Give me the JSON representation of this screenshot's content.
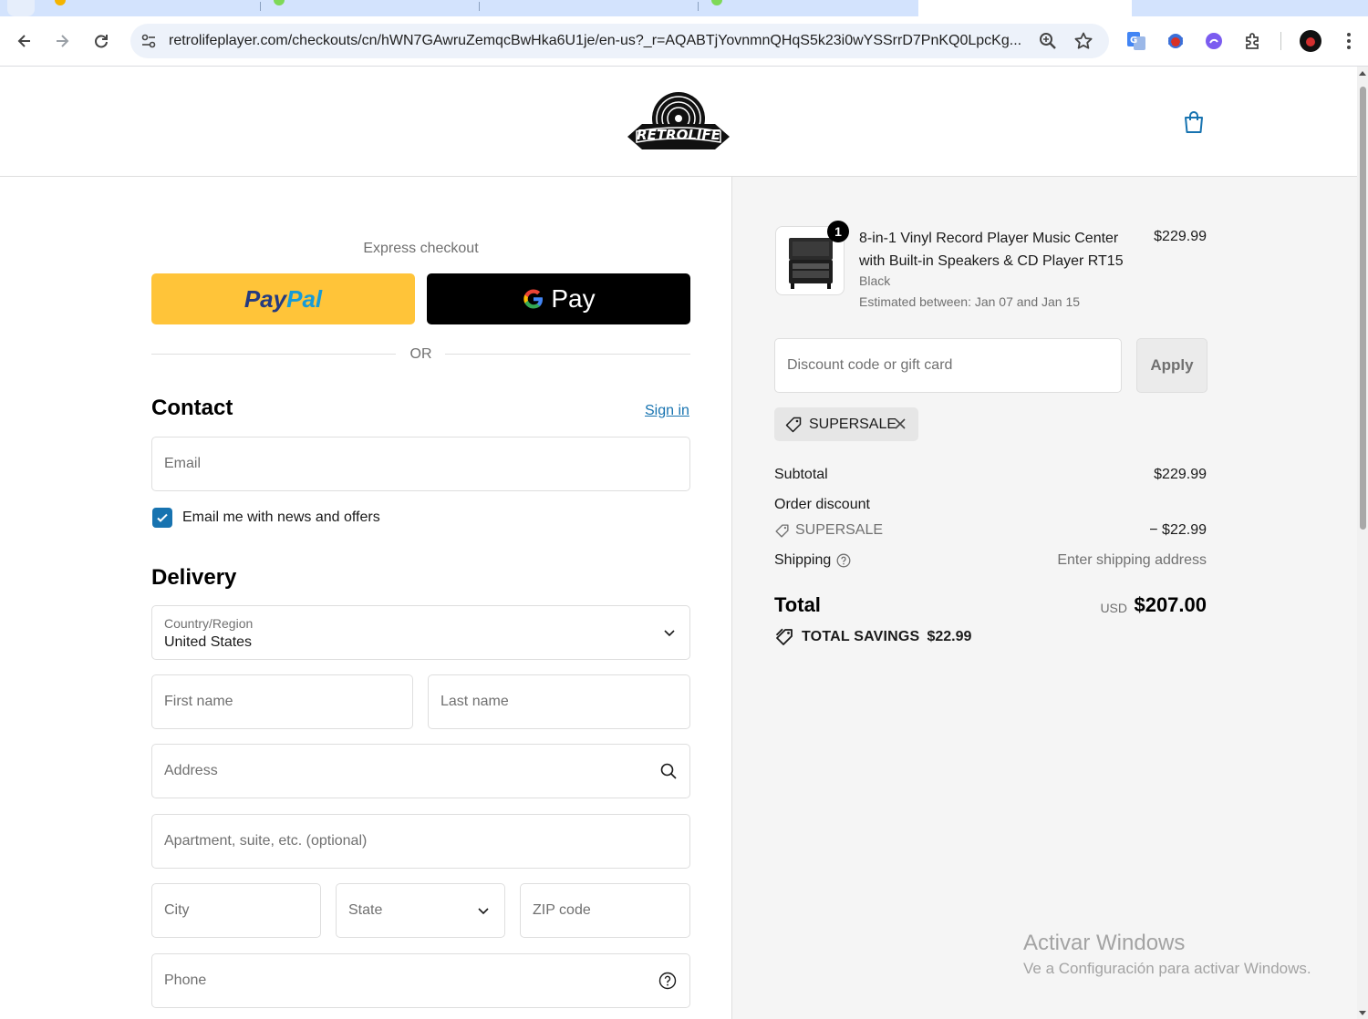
{
  "browser": {
    "url": "retrolifeplayer.com/checkouts/cn/hWN7GAwruZemqcBwHka6U1je/en-us?_r=AQABTjYovnmnQHqS5k23i0wYSSrrD7PnKQ0LpcKg...",
    "icons": [
      "back-icon",
      "forward-icon",
      "reload-icon",
      "site-settings-icon",
      "zoom-icon",
      "bookmark-star-icon",
      "translate-extension-icon",
      "bug-extension-icon",
      "purple-extension-icon",
      "puzzle-extensions-icon",
      "profile-avatar",
      "kebab-menu-icon"
    ]
  },
  "store": {
    "logo_text": "RETROLIFE",
    "cart_icon": "shopping-bag-icon"
  },
  "checkout": {
    "express_label": "Express checkout",
    "paypal_label_1": "Pay",
    "paypal_label_2": "Pal",
    "gpay_label": "Pay",
    "or_label": "OR",
    "contact_heading": "Contact",
    "sign_in": "Sign in",
    "email_placeholder": "Email",
    "newsletter_label": "Email me with news and offers",
    "newsletter_checked": true,
    "delivery_heading": "Delivery",
    "country_label": "Country/Region",
    "country_value": "United States",
    "first_name_placeholder": "First name",
    "last_name_placeholder": "Last name",
    "address_placeholder": "Address",
    "apartment_placeholder": "Apartment, suite, etc. (optional)",
    "city_placeholder": "City",
    "state_placeholder": "State",
    "zip_placeholder": "ZIP code",
    "phone_placeholder": "Phone"
  },
  "summary": {
    "item": {
      "quantity": "1",
      "title": "8-in-1 Vinyl Record Player Music Center with Built-in Speakers & CD Player RT15",
      "variant": "Black",
      "eta": "Estimated between: Jan 07 and Jan 15",
      "price": "$229.99"
    },
    "discount_placeholder": "Discount code or gift card",
    "apply_label": "Apply",
    "applied_code": "SUPERSALE",
    "subtotal_label": "Subtotal",
    "subtotal_value": "$229.99",
    "order_discount_label": "Order discount",
    "discount_code": "SUPERSALE",
    "discount_value": "− $22.99",
    "shipping_label": "Shipping",
    "shipping_value": "Enter shipping address",
    "total_label": "Total",
    "total_currency": "USD",
    "total_value": "$207.00",
    "savings_label": "TOTAL SAVINGS",
    "savings_value": "$22.99"
  },
  "watermark": {
    "line1": "Activar Windows",
    "line2": "Ve a Configuración para activar Windows."
  },
  "colors": {
    "accent": "#1773b0",
    "paypal_yellow": "#ffc439",
    "summary_bg": "#f5f5f5"
  }
}
